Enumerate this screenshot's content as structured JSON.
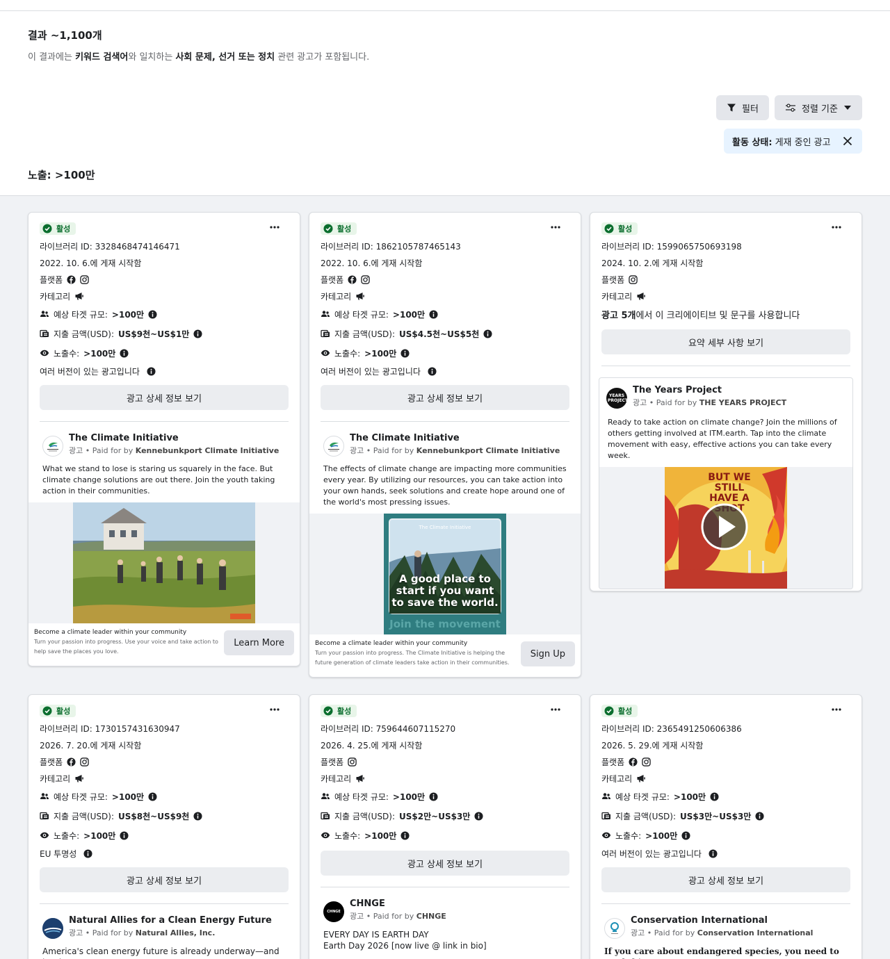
{
  "header": {
    "results_title": "결과 ~1,100개",
    "desc_prefix": "이 결과에는 ",
    "desc_bold1": "키워드 검색어",
    "desc_mid": "와 일치하는 ",
    "desc_bold2": "사회 문제, 선거 또는 정치",
    "desc_suffix": " 관련 광고가 포함됩니다.",
    "filter_label": "필터",
    "sort_label": "정렬 기준",
    "chip_bold": "활동 상태:",
    "chip_value": "게재 중인 광고",
    "impressions_heading": "노출: >100만"
  },
  "common": {
    "status": "활성",
    "platform_label": "플랫폼",
    "category_label": "카테고리",
    "target_label": "예상 타겟 규모:",
    "spend_label": "지출 금액(USD):",
    "impr_label": "노출수:",
    "detail_button": "광고 상세 정보 보기",
    "summary_button": "요약 세부 사항 보기",
    "ad_label": "광고 • Paid for by ",
    "multi_version": "여러 버전이 있는 광고입니다"
  },
  "cards": [
    {
      "library_id": "라이브러리 ID: 3328468474146471",
      "start": "2022. 10. 6.에 게재 시작함",
      "target": ">100만",
      "spend": "US$9천~US$1만",
      "impr": ">100만",
      "note": "여러 버전이 있는 광고입니다",
      "adv_name": "The Climate Initiative",
      "paid_by": "Kennebunkport Climate Initiative",
      "ad_text": "What we stand to lose is staring us squarely in the face. But climate change solutions are out there. Join the youth taking action in their communities.",
      "cta_head": "Become a climate leader within your community",
      "cta_sub": "Turn your passion into progress. Use your voice and take action to help save the places you love.",
      "cta_btn": "Learn More"
    },
    {
      "library_id": "라이브러리 ID: 1862105787465143",
      "start": "2022. 10. 6.에 게재 시작함",
      "target": ">100만",
      "spend": "US$4.5천~US$5천",
      "impr": ">100만",
      "note": "여러 버전이 있는 광고입니다",
      "adv_name": "The Climate Initiative",
      "paid_by": "Kennebunkport Climate Initiative",
      "ad_text": "The effects of climate change are impacting more communities every year. By utilizing our resources, you can take action into your own hands, seek solutions and create hope around one of the world's most pressing issues.",
      "image_logo": "The Climate Initiative",
      "image_text_1": "A good place to",
      "image_text_2": "start if you want",
      "image_text_3": "to save the world.",
      "image_text_4": "Join the movement",
      "cta_head": "Become a climate leader within your community",
      "cta_sub": "Turn your passion into progress. The Climate Initiative is helping the future generation of climate leaders take action in their communities.",
      "cta_btn": "Sign Up"
    },
    {
      "library_id": "라이브러리 ID: 1599065750693198",
      "start": "2024. 10. 2.에 게재 시작함",
      "uses_bold": "광고 5개",
      "uses_text": "에서 이 크리에이티브 및 문구를 사용합니다",
      "adv_name": "The Years Project",
      "adv_logo": "YEARS PROJECT",
      "paid_by": "THE YEARS PROJECT",
      "ad_text": "Ready to take action on climate change? Join the millions of others getting involved at ITM.earth. Tap into the climate movement with easy, effective actions you can take every week.",
      "image_text": "BUT WE STILL HAVE A SHOT"
    },
    {
      "library_id": "라이브러리 ID: 1730157431630947",
      "start": "2026. 7. 20.에 게재 시작함",
      "target": ">100만",
      "spend": "US$8천~US$9천",
      "impr": ">100만",
      "note": "EU 투명성",
      "adv_name": "Natural Allies for a Clean Energy Future",
      "paid_by": "Natural Allies, Inc.",
      "ad_text": "America's clean energy future is already underway—and it takes"
    },
    {
      "library_id": "라이브러리 ID: 759644607115270",
      "start": "2026. 4. 25.에 게재 시작함",
      "target": ">100만",
      "spend": "US$2만~US$3만",
      "impr": ">100만",
      "adv_name": "CHNGE",
      "adv_logo": "CHNGE",
      "paid_by": "CHNGE",
      "ad_text_1": "EVERY DAY IS EARTH DAY",
      "ad_text_2": "Earth Day 2026 [now live @ link in bio]"
    },
    {
      "library_id": "라이브러리 ID: 2365491250606386",
      "start": "2026. 5. 29.에 게재 시작함",
      "target": ">100만",
      "spend": "US$3만~US$3만",
      "impr": ">100만",
      "note": "여러 버전이 있는 광고입니다",
      "adv_name": "Conservation International",
      "paid_by": "Conservation International",
      "ad_text": "If you care about endangered species, you need to read this:"
    }
  ],
  "colors": {
    "active_green": "#0b6e2e",
    "accent_blue": "#e7f3ff"
  }
}
